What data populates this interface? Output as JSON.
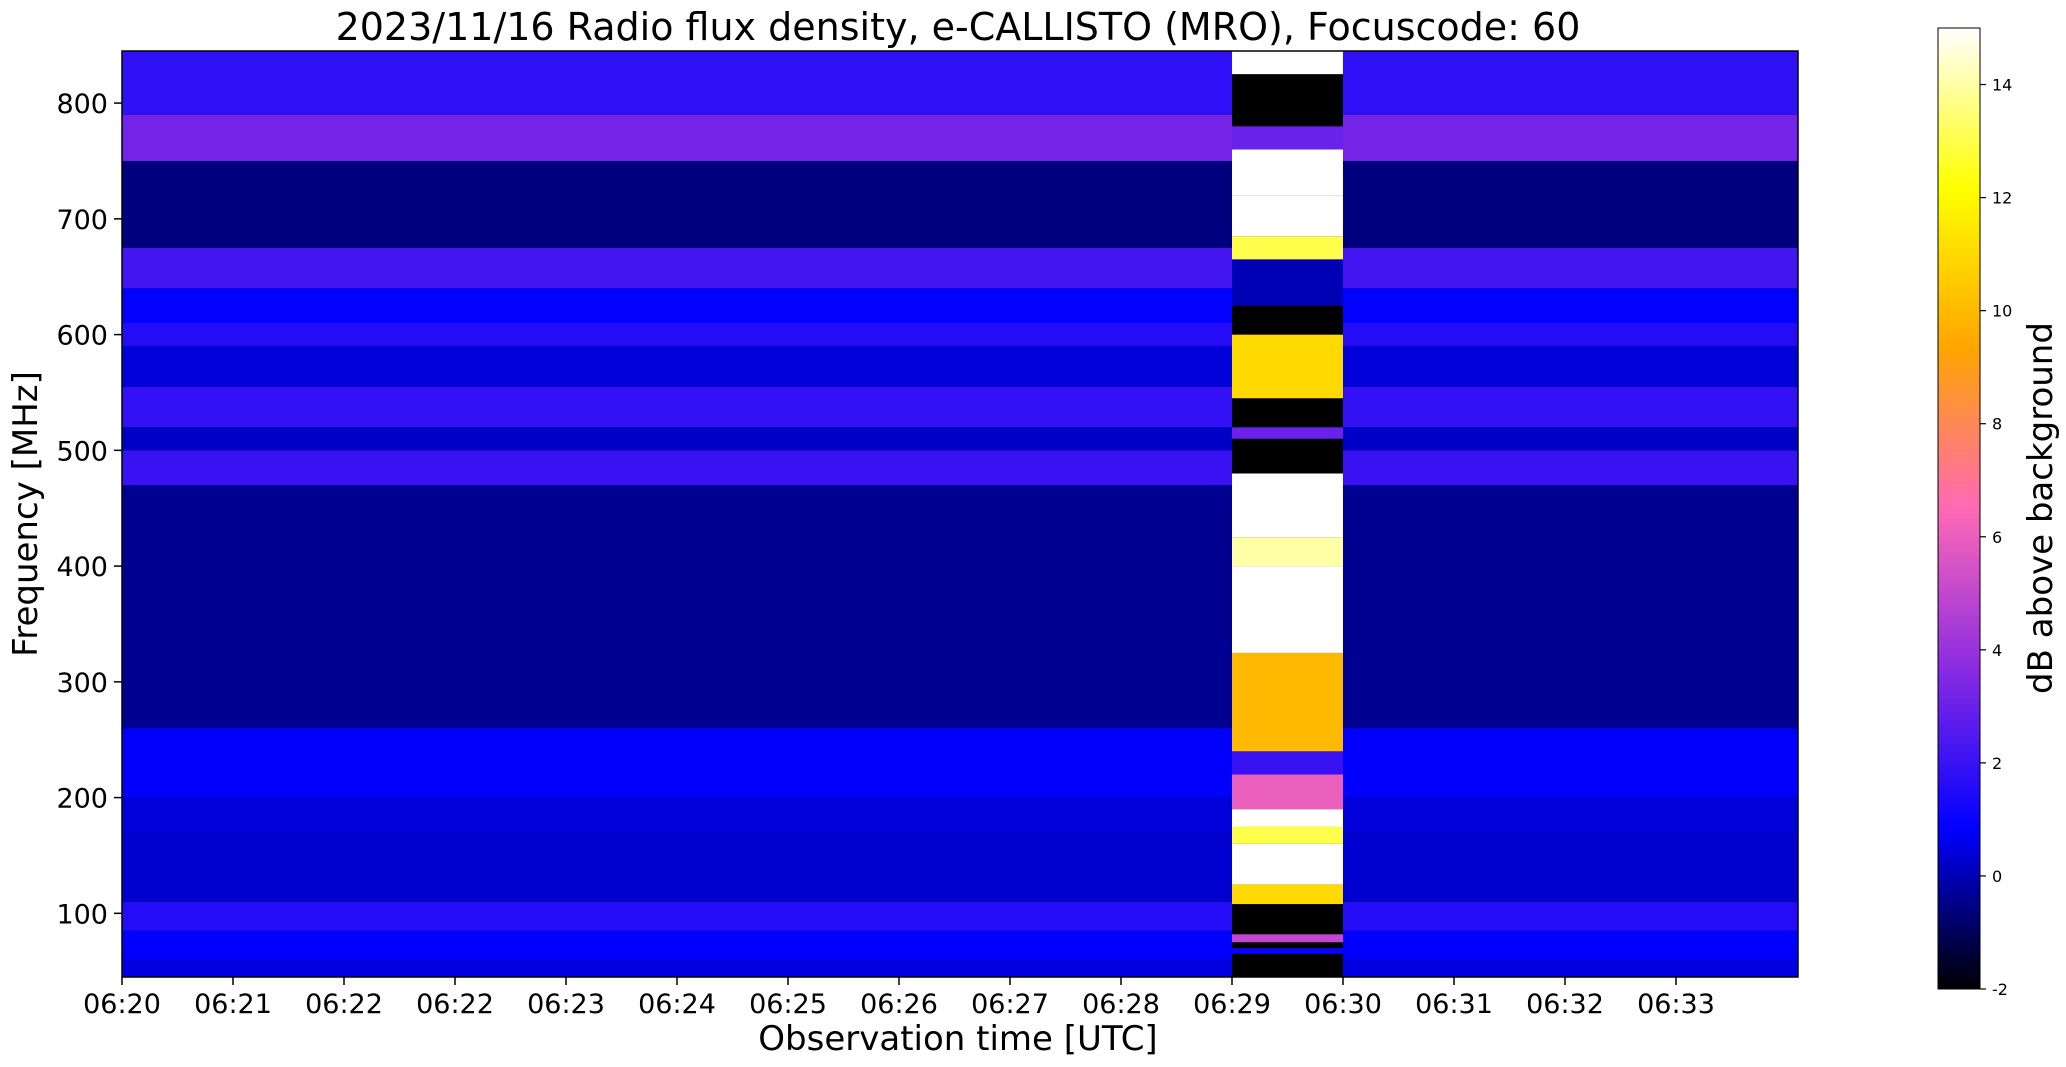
{
  "chart_data": {
    "type": "heatmap",
    "title": "2023/11/16  Radio flux density, e-CALLISTO (MRO), Focuscode: 60",
    "xlabel": "Observation time [UTC]",
    "ylabel": "Frequency [MHz]",
    "x_ticks": [
      "06:20",
      "06:21",
      "06:22",
      "06:22",
      "06:23",
      "06:24",
      "06:25",
      "06:26",
      "06:27",
      "06:28",
      "06:29",
      "06:30",
      "06:31",
      "06:32",
      "06:33"
    ],
    "y_ticks": [
      100,
      200,
      300,
      400,
      500,
      600,
      700,
      800
    ],
    "ylim": [
      45,
      845
    ],
    "colorbar": {
      "label": "dB above background",
      "ticks": [
        -2,
        0,
        2,
        4,
        6,
        8,
        10,
        12,
        14
      ],
      "range": [
        -2,
        15
      ],
      "colormap": "gnuplot2",
      "stops": [
        "#000000",
        "#0000ff",
        "#8a2be2",
        "#ff69b4",
        "#ffa500",
        "#ffff00",
        "#ffffff"
      ]
    },
    "background_bands_db": [
      {
        "f": [
          45,
          60
        ],
        "db": 0.5
      },
      {
        "f": [
          60,
          85
        ],
        "db": 0.8
      },
      {
        "f": [
          85,
          110
        ],
        "db": 1.6
      },
      {
        "f": [
          110,
          170
        ],
        "db": 0.3
      },
      {
        "f": [
          170,
          200
        ],
        "db": 0.4
      },
      {
        "f": [
          200,
          260
        ],
        "db": 0.8
      },
      {
        "f": [
          260,
          470
        ],
        "db": -0.4
      },
      {
        "f": [
          470,
          500
        ],
        "db": 2.0
      },
      {
        "f": [
          500,
          520
        ],
        "db": 0.2
      },
      {
        "f": [
          520,
          555
        ],
        "db": 1.9
      },
      {
        "f": [
          555,
          590
        ],
        "db": 0.4
      },
      {
        "f": [
          590,
          610
        ],
        "db": 1.6
      },
      {
        "f": [
          610,
          640
        ],
        "db": 0.9
      },
      {
        "f": [
          640,
          675
        ],
        "db": 2.2
      },
      {
        "f": [
          675,
          750
        ],
        "db": -0.6
      },
      {
        "f": [
          750,
          790
        ],
        "db": 3.2
      },
      {
        "f": [
          790,
          845
        ],
        "db": 1.8
      }
    ],
    "burst_window": {
      "t": [
        "06:29",
        "06:30"
      ]
    },
    "burst_bands_db": [
      {
        "f": [
          45,
          65
        ],
        "db": -2
      },
      {
        "f": [
          65,
          70
        ],
        "db": 1
      },
      {
        "f": [
          70,
          75
        ],
        "db": -2
      },
      {
        "f": [
          75,
          82
        ],
        "db": 5
      },
      {
        "f": [
          82,
          108
        ],
        "db": -2
      },
      {
        "f": [
          108,
          125
        ],
        "db": 11
      },
      {
        "f": [
          125,
          160
        ],
        "db": 15
      },
      {
        "f": [
          160,
          175
        ],
        "db": 13
      },
      {
        "f": [
          175,
          190
        ],
        "db": 15
      },
      {
        "f": [
          190,
          220
        ],
        "db": 6
      },
      {
        "f": [
          220,
          240
        ],
        "db": 2
      },
      {
        "f": [
          240,
          325
        ],
        "db": 10
      },
      {
        "f": [
          325,
          400
        ],
        "db": 15
      },
      {
        "f": [
          400,
          425
        ],
        "db": 14
      },
      {
        "f": [
          425,
          480
        ],
        "db": 15
      },
      {
        "f": [
          480,
          510
        ],
        "db": -2
      },
      {
        "f": [
          510,
          520
        ],
        "db": 3
      },
      {
        "f": [
          520,
          545
        ],
        "db": -2
      },
      {
        "f": [
          545,
          600
        ],
        "db": 11
      },
      {
        "f": [
          600,
          625
        ],
        "db": -2
      },
      {
        "f": [
          625,
          665
        ],
        "db": 0
      },
      {
        "f": [
          665,
          685
        ],
        "db": 13
      },
      {
        "f": [
          685,
          720
        ],
        "db": 15
      },
      {
        "f": [
          720,
          760
        ],
        "db": 15
      },
      {
        "f": [
          760,
          780
        ],
        "db": 3
      },
      {
        "f": [
          780,
          825
        ],
        "db": -2
      },
      {
        "f": [
          825,
          845
        ],
        "db": 15
      }
    ]
  }
}
